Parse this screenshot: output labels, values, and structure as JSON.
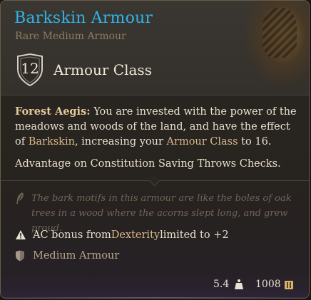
{
  "item": {
    "name": "Barkskin Armour",
    "rarity_type": "Rare Medium Armour",
    "armour_class_value": "12",
    "armour_class_label": "Armour Class"
  },
  "description": {
    "ability_name": "Forest Aegis:",
    "text_1": " You are invested with the power of the meadows and woods of the land, and have the effect of ",
    "barkskin": "Barkskin",
    "text_2": ", increasing your ",
    "armour_class": "Armour Class",
    "text_3": " to 16.",
    "advantage": "Advantage",
    "text_4": " on ",
    "saving_throws": "Constitution Saving Throws",
    "text_5": " ",
    "checks": "Checks",
    "text_6": "."
  },
  "flavor_text": "The bark motifs in this armour are like the boles of oak trees in a wood where the acorns slept long, and grew proud.",
  "properties": {
    "ac_bonus_prefix": "AC bonus from ",
    "dexterity": "Dexterity",
    "ac_bonus_suffix": " limited to +2",
    "armour_type": "Medium Armour"
  },
  "footer": {
    "weight": "5.4",
    "price": "1008"
  },
  "colors": {
    "title": "#2fb4e8",
    "keyword": "#d9b98a",
    "rarity": "#8e7d63"
  },
  "icons": {
    "ac": "shield-icon",
    "flavor": "feather-icon",
    "warning": "warning-triangle-icon",
    "armour": "armour-shield-icon",
    "weight": "weight-icon",
    "gold": "gold-coin-icon"
  }
}
